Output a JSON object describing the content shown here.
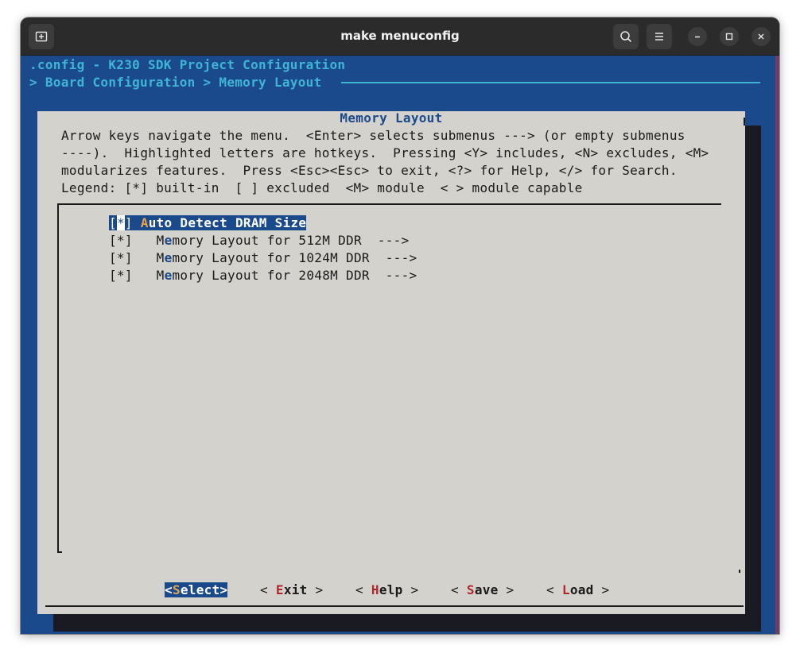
{
  "window": {
    "title": "make menuconfig"
  },
  "icons": {
    "new_tab": "new-tab-icon",
    "search": "search-icon",
    "menu": "hamburger-menu-icon",
    "minimize": "minimize-icon",
    "maximize": "maximize-icon",
    "close": "close-icon"
  },
  "colors": {
    "terminal_bg": "#1b4a8c",
    "header_text": "#3fb5d6",
    "dialog_bg": "#d4d2cc",
    "highlight_bg": "#1b4a8c",
    "hotkey_red": "#b2242b"
  },
  "header": {
    "config_title": ".config - K230 SDK Project Configuration",
    "breadcrumb": "> Board Configuration > Memory Layout "
  },
  "dialog": {
    "title": "Memory Layout",
    "help_lines": [
      "Arrow keys navigate the menu.  <Enter> selects submenus ---> (or empty submenus",
      "----).  Highlighted letters are hotkeys.  Pressing <Y> includes, <N> excludes, <M>",
      "modularizes features.  Press <Esc><Esc> to exit, <?> for Help, </> for Search.",
      "Legend: [*] built-in  [ ] excluded  <M> module  < > module capable"
    ]
  },
  "menu": {
    "items": [
      {
        "mark_open": "[",
        "mark_star": "*",
        "mark_close": "]",
        "hotkey": "A",
        "rest": "uto Detect DRAM Size",
        "suffix": "",
        "selected": true
      },
      {
        "mark": "[*]",
        "prefix": "M",
        "hotkey": "e",
        "rest": "mory Layout for 512M DDR",
        "suffix": "--->"
      },
      {
        "mark": "[*]",
        "prefix": "M",
        "hotkey": "e",
        "rest": "mory Layout for 1024M DDR",
        "suffix": "--->"
      },
      {
        "mark": "[*]",
        "prefix": "M",
        "hotkey": "e",
        "rest": "mory Layout for 2048M DDR",
        "suffix": "--->"
      }
    ]
  },
  "buttons": {
    "select": {
      "open": "<",
      "hotkey": "S",
      "rest": "elect",
      "close": ">"
    },
    "exit": {
      "open": "< ",
      "hotkey": "E",
      "rest": "xit",
      "close": " >"
    },
    "help": {
      "open": "< ",
      "hotkey": "H",
      "rest": "elp",
      "close": " >"
    },
    "save": {
      "open": "< ",
      "hotkey": "S",
      "rest": "ave",
      "close": " >"
    },
    "load": {
      "open": "< ",
      "hotkey": "L",
      "rest": "oad",
      "close": " >"
    }
  }
}
